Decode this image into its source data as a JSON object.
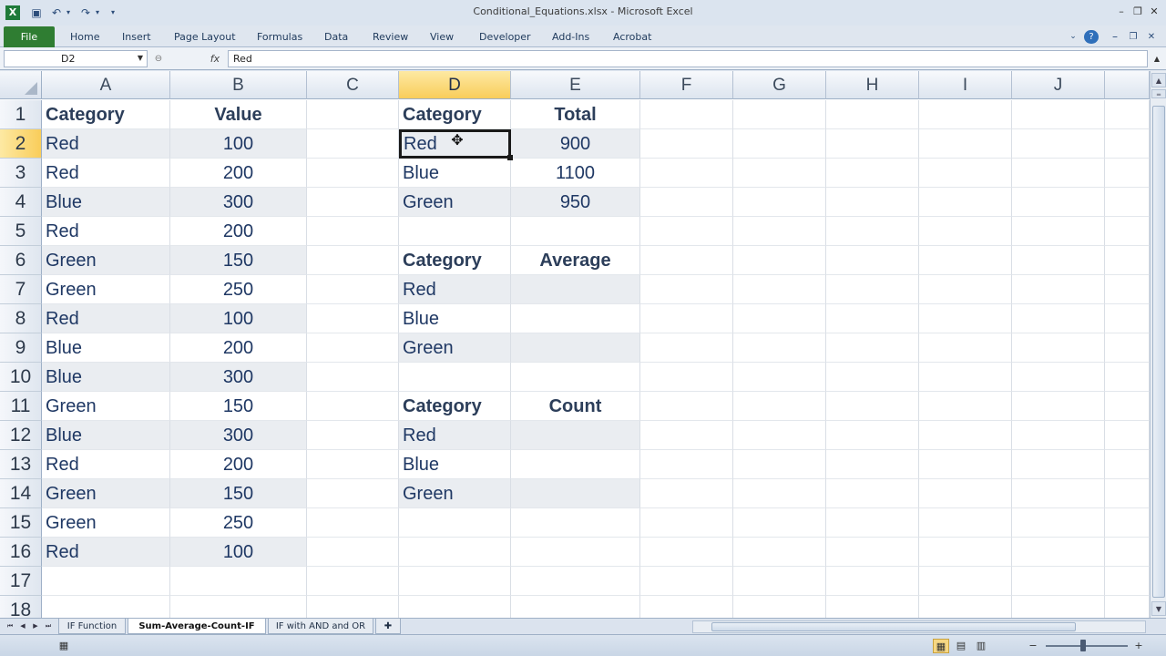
{
  "window": {
    "title": "Conditional_Equations.xlsx - Microsoft Excel",
    "app_icon": "excel-icon",
    "controls": [
      "minimize-icon",
      "restore-icon",
      "close-icon"
    ]
  },
  "quick_access": [
    "save-icon",
    "undo-icon",
    "redo-icon",
    "customize-icon"
  ],
  "ribbon": {
    "file_tab": "File",
    "tabs": [
      "Home",
      "Insert",
      "Page Layout",
      "Formulas",
      "Data",
      "Review",
      "View",
      "Developer",
      "Add-Ins",
      "Acrobat"
    ],
    "right_icons": [
      "minimize-ribbon-icon",
      "help-icon",
      "minimize-icon",
      "restore-icon",
      "close-icon"
    ]
  },
  "formula_bar": {
    "name_box": "D2",
    "fx": "fx",
    "content": "Red"
  },
  "sheet": {
    "columns": [
      "A",
      "B",
      "C",
      "D",
      "E",
      "F",
      "G",
      "H",
      "I",
      "J"
    ],
    "selected_column": "D",
    "rows": [
      "1",
      "2",
      "3",
      "4",
      "5",
      "6",
      "7",
      "8",
      "9",
      "10",
      "11",
      "12",
      "13",
      "14",
      "15",
      "16",
      "17",
      "18"
    ],
    "selected_row": "2",
    "active_cell": "D2",
    "data_table": {
      "headers": [
        "Category",
        "Value"
      ],
      "rows": [
        [
          "Red",
          "100"
        ],
        [
          "Red",
          "200"
        ],
        [
          "Blue",
          "300"
        ],
        [
          "Red",
          "200"
        ],
        [
          "Green",
          "150"
        ],
        [
          "Green",
          "250"
        ],
        [
          "Red",
          "100"
        ],
        [
          "Blue",
          "200"
        ],
        [
          "Blue",
          "300"
        ],
        [
          "Green",
          "150"
        ],
        [
          "Blue",
          "300"
        ],
        [
          "Red",
          "200"
        ],
        [
          "Green",
          "150"
        ],
        [
          "Green",
          "250"
        ],
        [
          "Red",
          "100"
        ]
      ]
    },
    "total_table": {
      "headers": [
        "Category",
        "Total"
      ],
      "rows": [
        [
          "Red",
          "900"
        ],
        [
          "Blue",
          "1100"
        ],
        [
          "Green",
          "950"
        ]
      ]
    },
    "average_table": {
      "headers": [
        "Category",
        "Average"
      ],
      "rows": [
        [
          "Red",
          ""
        ],
        [
          "Blue",
          ""
        ],
        [
          "Green",
          ""
        ]
      ]
    },
    "count_table": {
      "headers": [
        "Category",
        "Count"
      ],
      "rows": [
        [
          "Red",
          ""
        ],
        [
          "Blue",
          ""
        ],
        [
          "Green",
          ""
        ]
      ]
    }
  },
  "sheet_tabs": {
    "tabs": [
      "IF Function",
      "Sum-Average-Count-IF",
      "IF with AND and OR"
    ],
    "active": "Sum-Average-Count-IF",
    "insert_icon": "insert-sheet-icon"
  },
  "status_bar": {
    "view_icons": [
      "normal-view-icon",
      "page-layout-view-icon",
      "page-break-view-icon"
    ],
    "zoom_out": "−",
    "zoom_in": "+"
  },
  "colors": {
    "file_tab": "#2f7d32",
    "selected_header": "#f9cd5a",
    "band": "#eaedf1",
    "cell_text": "#1f3864"
  }
}
